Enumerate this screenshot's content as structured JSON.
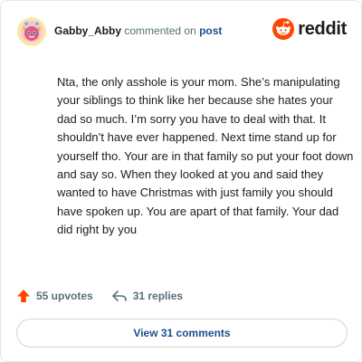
{
  "comment": {
    "author": "Gabby_Abby",
    "action_text": "commented on",
    "target_link": "post",
    "body": "Nta, the only asshole is your mom. She’s manipulating your siblings to think like her because she hates your dad so much. I’m sorry you have to deal with that. It shouldn’t have ever happened. Next time stand up for yourself tho. Your are in that family so put your foot down and say so. When they looked at you and said they wanted to have Christmas with just family you should have spoken up. You are apart of that family. Your dad did right by you"
  },
  "brand": {
    "name": "reddit",
    "icon": "reddit-logo-icon",
    "color": "#ff4500"
  },
  "avatar": {
    "icon": "avatar-icon"
  },
  "actions": {
    "upvotes": "55 upvotes",
    "upvote_icon": "upvote-arrow-icon",
    "upvote_color": "#ff4500",
    "replies": "31 replies",
    "reply_icon": "reply-arrow-icon"
  },
  "footer": {
    "view_comments": "View 31 comments"
  },
  "colors": {
    "link": "#1d4f91",
    "muted": "#576f76",
    "text": "#1c1c1c"
  }
}
